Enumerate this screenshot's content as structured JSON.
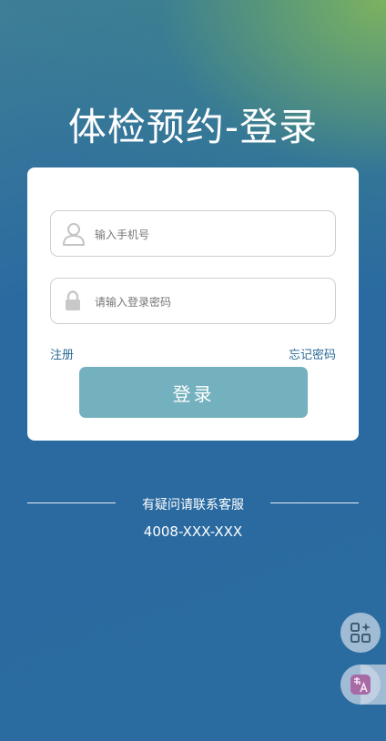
{
  "page": {
    "title": "体检预约-登录"
  },
  "login_form": {
    "phone_placeholder": "输入手机号",
    "password_placeholder": "请输入登录密码",
    "register_label": "注册",
    "forgot_label": "忘记密码",
    "login_button_label": "登录"
  },
  "support": {
    "help_text": "有疑问请联系客服",
    "hotline": "4008-XXX-XXX"
  },
  "floating_buttons": [
    {
      "icon": "apps-sparkle-icon"
    },
    {
      "icon": "translate-icon"
    }
  ],
  "colors": {
    "background": "#2a6ba0",
    "accent_top_right": "#7db260",
    "button": "#74b1be",
    "link": "#2a6a94"
  }
}
